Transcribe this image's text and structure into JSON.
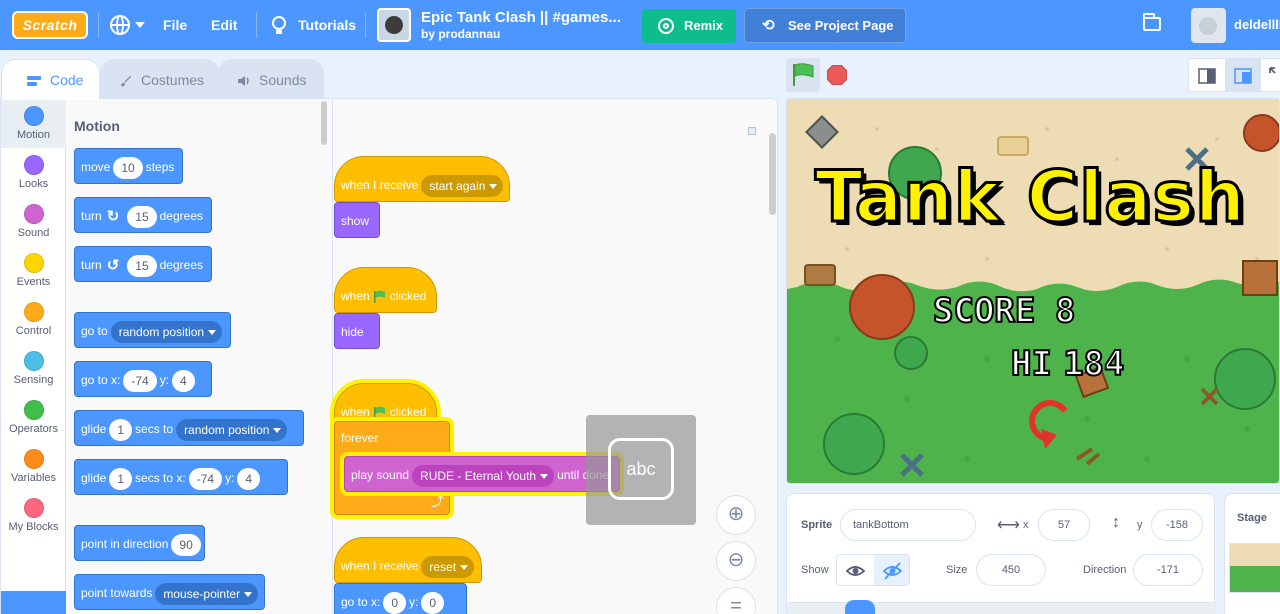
{
  "menubar": {
    "logo": "Scratch",
    "file": "File",
    "edit": "Edit",
    "tutorials": "Tutorials",
    "project_title": "Epic Tank Clash || #games...",
    "project_author": "by prodannau",
    "remix": "Remix",
    "see_project_page": "See Project Page",
    "username": "deldelllll"
  },
  "tabs": {
    "code": "Code",
    "costumes": "Costumes",
    "sounds": "Sounds"
  },
  "categories": [
    {
      "label": "Motion",
      "color": "#4c97ff"
    },
    {
      "label": "Looks",
      "color": "#9966ff"
    },
    {
      "label": "Sound",
      "color": "#cf63cf"
    },
    {
      "label": "Events",
      "color": "#ffd500"
    },
    {
      "label": "Control",
      "color": "#ffab19"
    },
    {
      "label": "Sensing",
      "color": "#4cbfe6"
    },
    {
      "label": "Operators",
      "color": "#40bf4a"
    },
    {
      "label": "Variables",
      "color": "#ff8c1a"
    },
    {
      "label": "My Blocks",
      "color": "#ff6680"
    }
  ],
  "palette": {
    "title": "Motion",
    "move": {
      "a": "move",
      "v": "10",
      "b": "steps"
    },
    "turn_right": {
      "a": "turn",
      "v": "15",
      "b": "degrees"
    },
    "turn_left": {
      "a": "turn",
      "v": "15",
      "b": "degrees"
    },
    "goto": {
      "a": "go to",
      "dd": "random position"
    },
    "goto_xy": {
      "a": "go to x:",
      "x": "-74",
      "y_label": "y:",
      "y": "4"
    },
    "glide_to": {
      "a": "glide",
      "v": "1",
      "b": "secs to",
      "dd": "random position"
    },
    "glide_xy": {
      "a": "glide",
      "v": "1",
      "b": "secs to x:",
      "x": "-74",
      "y_label": "y:",
      "y": "4"
    },
    "point_dir": {
      "a": "point in direction",
      "v": "90"
    },
    "point_towards": {
      "a": "point towards",
      "dd": "mouse-pointer"
    }
  },
  "scripts": {
    "s1": {
      "hat": "when I receive",
      "dd": "start again",
      "stmt": "show"
    },
    "s2": {
      "hat_a": "when",
      "hat_b": "clicked",
      "stmt": "hide"
    },
    "s3": {
      "hat_a": "when",
      "hat_b": "clicked",
      "loop": "forever",
      "play": "play sound",
      "sound": "RUDE - Eternal Youth",
      "until": "until done"
    },
    "s4": {
      "hat": "when I receive",
      "dd": "reset",
      "goto": "go to x:",
      "x": "0",
      "y_label": "y:",
      "y": "0"
    }
  },
  "drag_tip": "abc",
  "stage_title": {
    "line1": "Tank Clash",
    "score_label": "SCORE",
    "score": "8",
    "hi_label": "HI",
    "hi": "184"
  },
  "sprite": {
    "label": "Sprite",
    "name": "tankBottom",
    "x_label": "x",
    "x": "57",
    "y_label": "y",
    "y": "-158",
    "show_label": "Show",
    "size_label": "Size",
    "size": "450",
    "direction_label": "Direction",
    "direction": "-171"
  },
  "stage_pane_label": "Stage",
  "colors": {
    "motion": "#4c97ff",
    "events": "#ffbf00",
    "control": "#ffab19",
    "remix": "#0fbd8c",
    "menubar": "#4c97ff"
  }
}
